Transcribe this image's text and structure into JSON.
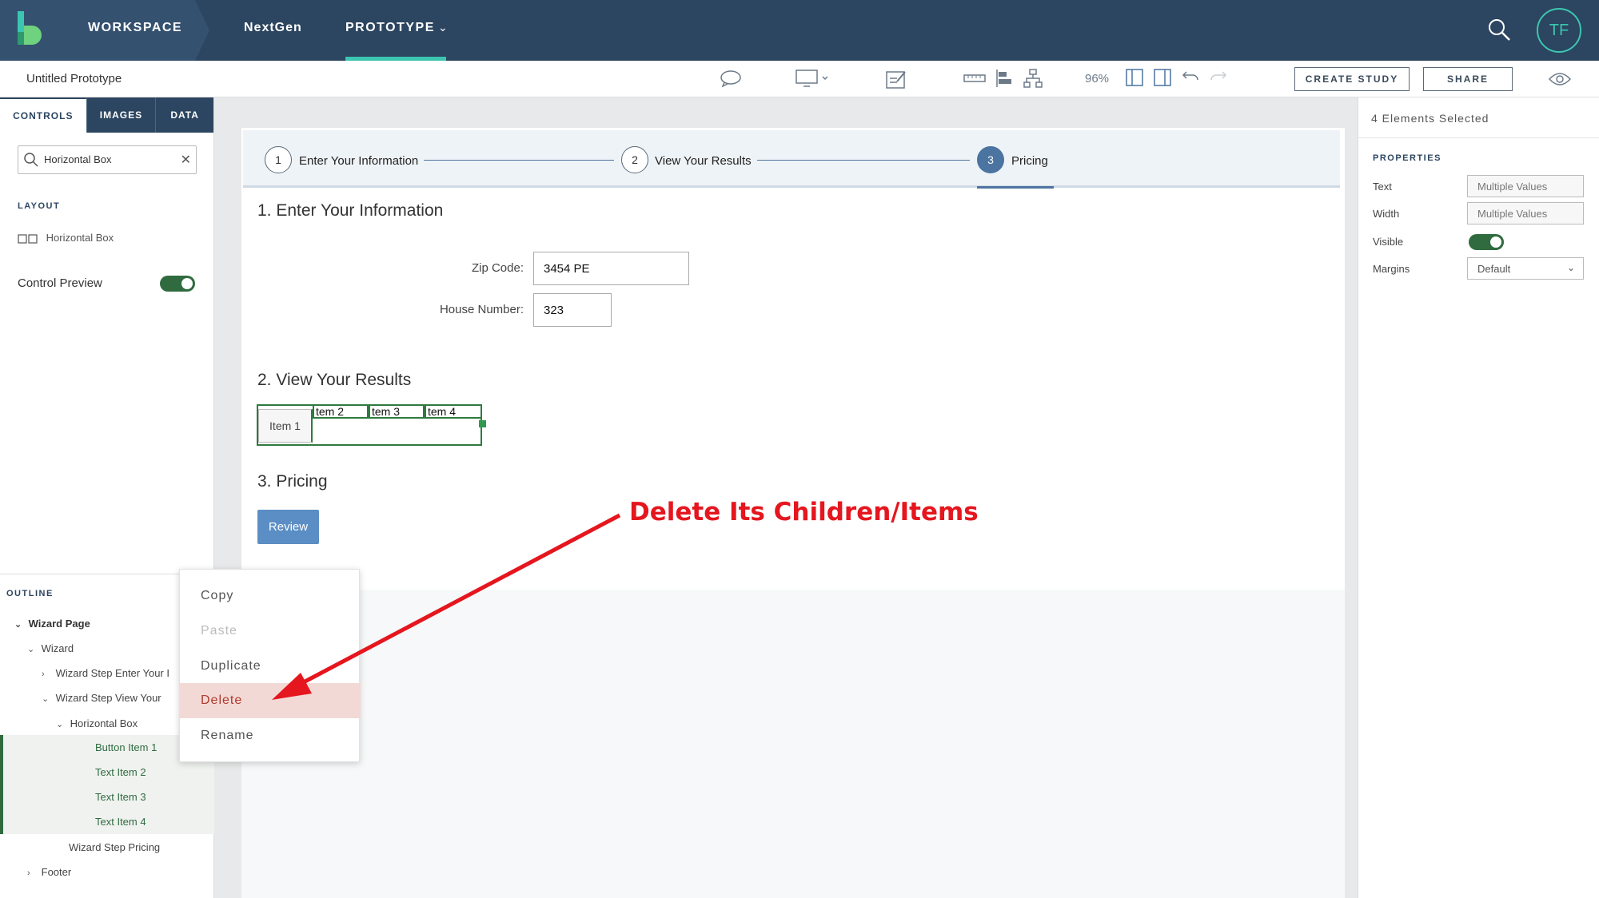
{
  "topbar": {
    "workspace": "WORKSPACE",
    "nextgen": "NextGen",
    "prototype": "PROTOTYPE",
    "avatar": "TF"
  },
  "toolbar": {
    "doc_title": "Untitled Prototype",
    "zoom": "96%",
    "create_study": "CREATE STUDY",
    "share": "SHARE"
  },
  "left": {
    "tabs": [
      "CONTROLS",
      "IMAGES",
      "DATA"
    ],
    "search_value": "Horizontal Box",
    "layout_label": "LAYOUT",
    "layout_item": "Horizontal Box",
    "control_preview": "Control Preview",
    "control_preview_on": true,
    "outline_label": "OUTLINE",
    "outline": [
      {
        "label": "Wizard Page"
      },
      {
        "label": "Wizard"
      },
      {
        "label": "Wizard Step Enter Your I"
      },
      {
        "label": "Wizard Step View Your"
      },
      {
        "label": "Horizontal Box"
      },
      {
        "label": "Button Item 1"
      },
      {
        "label": "Text Item 2"
      },
      {
        "label": "Text Item 3"
      },
      {
        "label": "Text Item 4"
      },
      {
        "label": "Wizard Step Pricing"
      },
      {
        "label": "Footer"
      }
    ]
  },
  "wizard": {
    "steps": [
      {
        "num": "1",
        "label": "Enter Your Information"
      },
      {
        "num": "2",
        "label": "View Your Results"
      },
      {
        "num": "3",
        "label": "Pricing"
      }
    ],
    "section1": "1. Enter Your Information",
    "zip_label": "Zip Code:",
    "zip_value": "3454 PE",
    "house_label": "House Number:",
    "house_value": "323",
    "section2": "2. View Your Results",
    "items": [
      "Item 1",
      "tem 2",
      "tem 3",
      "tem 4"
    ],
    "section3": "3. Pricing",
    "review": "Review"
  },
  "context_menu": [
    "Copy",
    "Paste",
    "Duplicate",
    "Delete",
    "Rename"
  ],
  "annotation": "Delete Its Children/Items",
  "right": {
    "selected": "4 Elements Selected",
    "properties_label": "PROPERTIES",
    "props": [
      {
        "label": "Text",
        "value": "Multiple Values"
      },
      {
        "label": "Width",
        "value": "Multiple Values"
      },
      {
        "label": "Visible",
        "value": ""
      },
      {
        "label": "Margins",
        "value": "Default"
      }
    ]
  },
  "colors": {
    "topbar": "#2c4560",
    "accent_teal": "#3cc6b1",
    "selection_green": "#2f7a3f",
    "annotation_red": "#e5161e"
  }
}
